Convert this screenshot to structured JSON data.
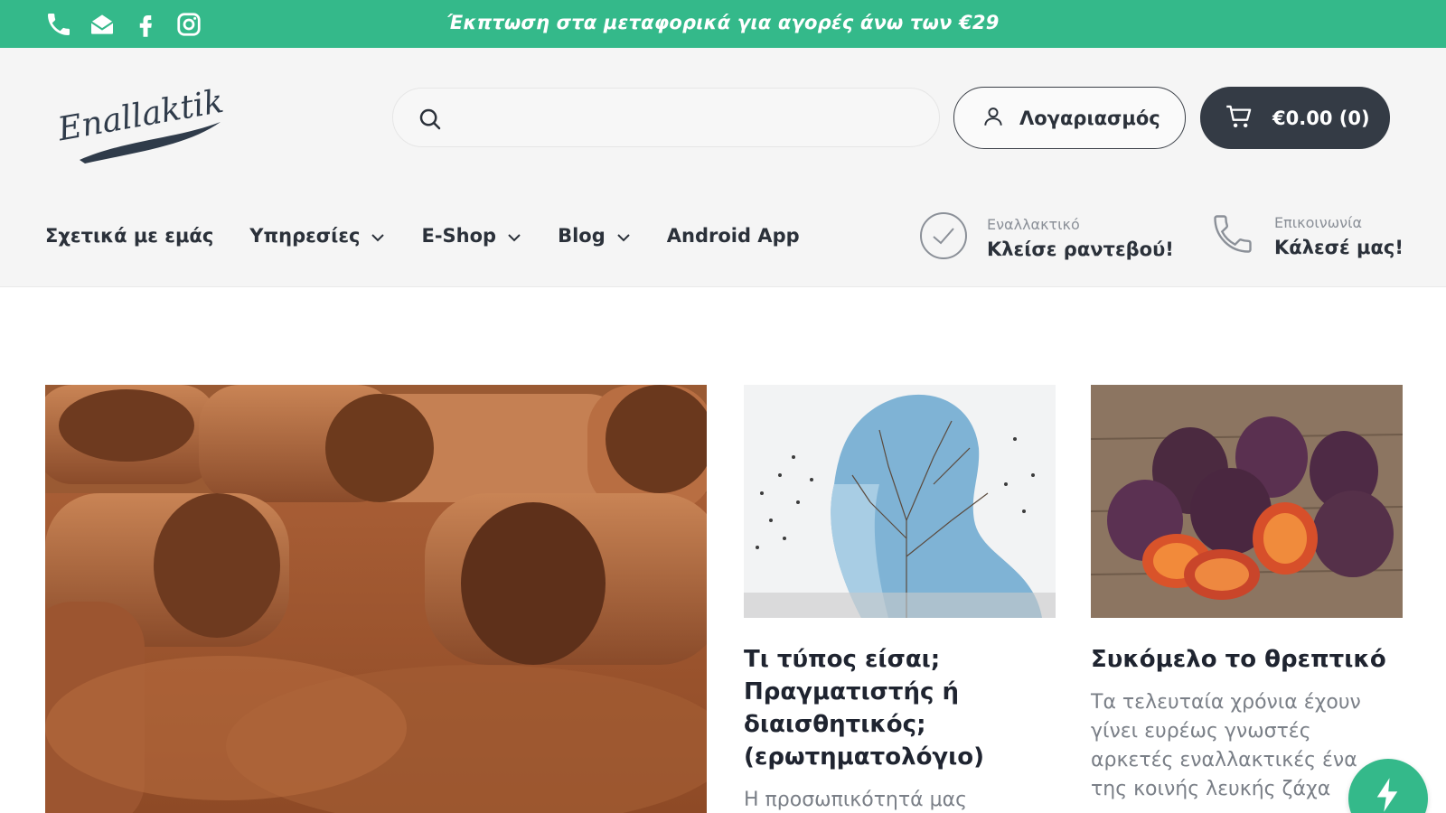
{
  "topbar": {
    "promo": "Έκπτωση στα μεταφορικά για αγορές άνω των €29",
    "icons": [
      "phone-icon",
      "mail-icon",
      "facebook-icon",
      "instagram-icon"
    ],
    "background": "#34b98a"
  },
  "header": {
    "logo_text": "Enallaktiko",
    "search": {
      "value": "",
      "placeholder": ""
    },
    "account_label": "Λογαριασμός",
    "cart_label": "€0.00 (0)",
    "cart_background": "#343b45"
  },
  "nav": {
    "items": [
      {
        "label": "Σχετικά με εμάς",
        "dropdown": false
      },
      {
        "label": "Υπηρεσίες",
        "dropdown": true
      },
      {
        "label": "E-Shop",
        "dropdown": true
      },
      {
        "label": "Blog",
        "dropdown": true
      },
      {
        "label": "Android App",
        "dropdown": false
      }
    ]
  },
  "cta": {
    "appointment": {
      "small": "Εναλλακτικό",
      "big": "Κλείσε ραντεβού!"
    },
    "contact": {
      "small": "Επικοινωνία",
      "big": "Κάλεσέ μας!"
    }
  },
  "posts": {
    "post1": {
      "title": [
        "Τι τύπος είσαι;",
        "Πραγματιστής ή",
        "διαισθητικός;",
        "(ερωτηματολόγιο)"
      ],
      "excerpt": [
        "Η προσωπικότητά μας"
      ]
    },
    "post2": {
      "title": [
        "Συκόμελο το θρεπτικό"
      ],
      "excerpt": [
        "Τα τελευταία χρόνια έχουν",
        "γίνει ευρέως γνωστές",
        "αρκετές εναλλακτικές ένα",
        "της κοινής λευκής ζάχα"
      ]
    }
  }
}
